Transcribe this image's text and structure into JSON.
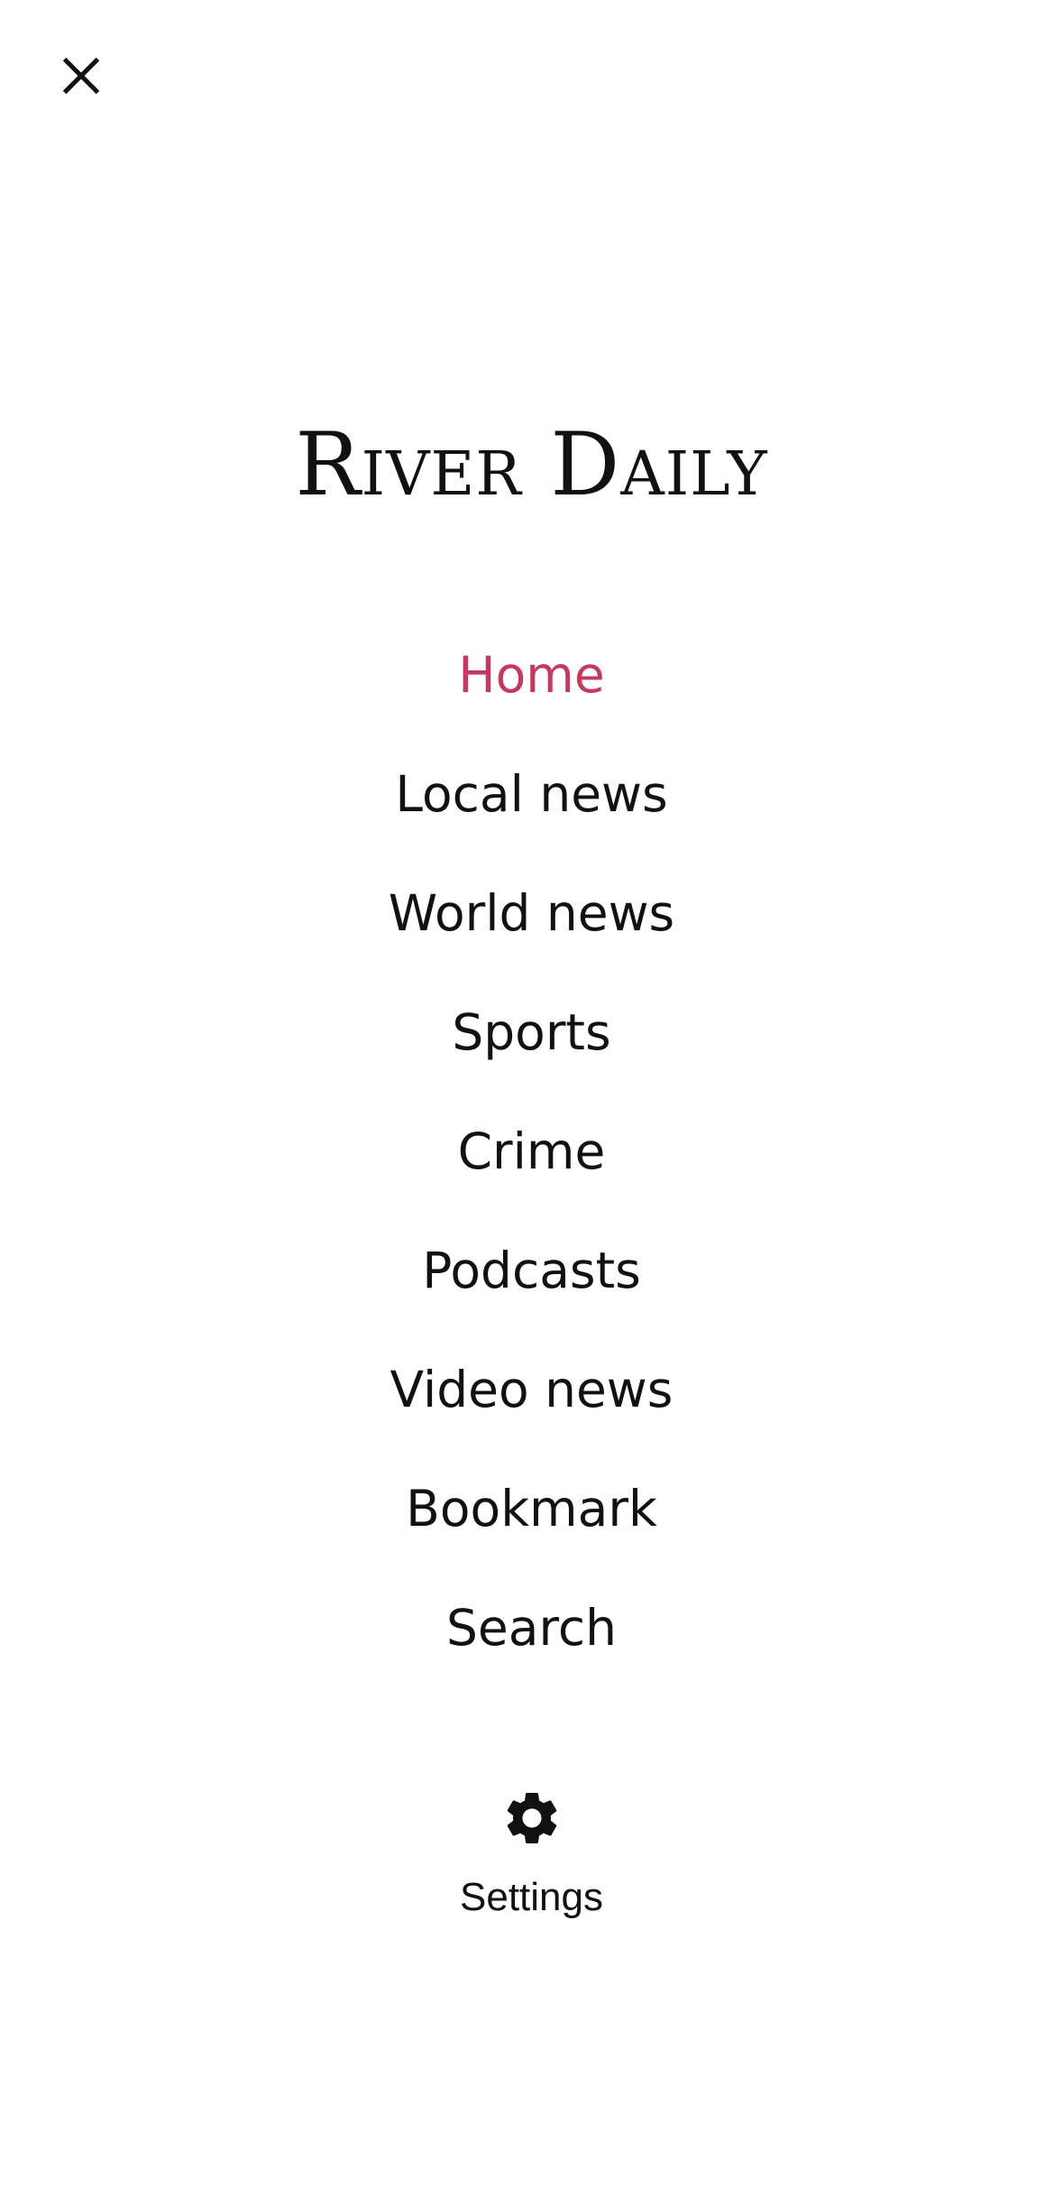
{
  "header": {
    "close_icon": "close-icon"
  },
  "brand": {
    "title": "River Daily"
  },
  "colors": {
    "accent": "#c8385d",
    "text": "#111111",
    "background": "#ffffff"
  },
  "nav": {
    "items": [
      {
        "label": "Home",
        "active": true
      },
      {
        "label": "Local news",
        "active": false
      },
      {
        "label": "World news",
        "active": false
      },
      {
        "label": "Sports",
        "active": false
      },
      {
        "label": "Crime",
        "active": false
      },
      {
        "label": "Podcasts",
        "active": false
      },
      {
        "label": "Video news",
        "active": false
      },
      {
        "label": "Bookmark",
        "active": false
      },
      {
        "label": "Search",
        "active": false
      }
    ]
  },
  "settings": {
    "icon": "gear-icon",
    "label": "Settings"
  }
}
